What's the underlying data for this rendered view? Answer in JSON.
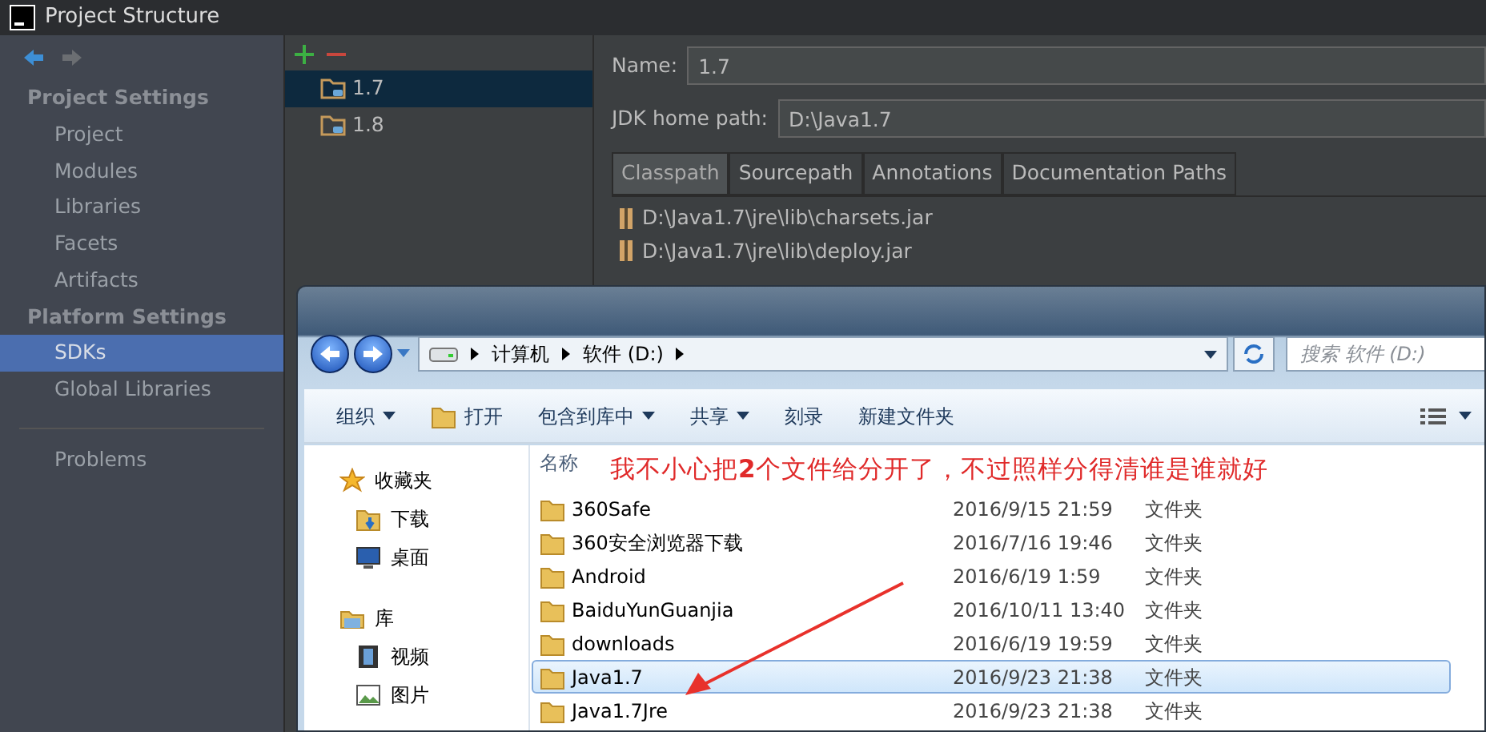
{
  "window": {
    "title": "Project Structure"
  },
  "sidebar": {
    "sections": [
      {
        "title": "Project Settings",
        "items": [
          {
            "label": "Project",
            "selected": false
          },
          {
            "label": "Modules",
            "selected": false
          },
          {
            "label": "Libraries",
            "selected": false
          },
          {
            "label": "Facets",
            "selected": false
          },
          {
            "label": "Artifacts",
            "selected": false
          }
        ]
      },
      {
        "title": "Platform Settings",
        "items": [
          {
            "label": "SDKs",
            "selected": true
          },
          {
            "label": "Global Libraries",
            "selected": false
          }
        ]
      }
    ],
    "footer_items": [
      {
        "label": "Problems",
        "selected": false
      }
    ]
  },
  "sdk_list": {
    "items": [
      {
        "label": "1.7",
        "selected": true
      },
      {
        "label": "1.8",
        "selected": false
      }
    ]
  },
  "details": {
    "name_label": "Name:",
    "name_value": "1.7",
    "path_label": "JDK home path:",
    "path_value": "D:\\Java1.7",
    "tabs": [
      {
        "label": "Classpath",
        "selected": true
      },
      {
        "label": "Sourcepath",
        "selected": false
      },
      {
        "label": "Annotations",
        "selected": false
      },
      {
        "label": "Documentation Paths",
        "selected": false
      }
    ],
    "classpath": [
      "D:\\Java1.7\\jre\\lib\\charsets.jar",
      "D:\\Java1.7\\jre\\lib\\deploy.jar"
    ]
  },
  "explorer": {
    "breadcrumb": [
      "计算机",
      "软件 (D:)"
    ],
    "search": {
      "placeholder": "搜索 软件 (D:)"
    },
    "toolbar": [
      {
        "label": "组织",
        "kind": "menu"
      },
      {
        "label": "打开",
        "kind": "open"
      },
      {
        "label": "包含到库中",
        "kind": "menu"
      },
      {
        "label": "共享",
        "kind": "menu"
      },
      {
        "label": "刻录",
        "kind": "plain"
      },
      {
        "label": "新建文件夹",
        "kind": "plain"
      }
    ],
    "nav": [
      {
        "label": "收藏夹",
        "kind": "star",
        "children": [
          {
            "label": "下载",
            "kind": "download"
          },
          {
            "label": "桌面",
            "kind": "desktop"
          }
        ]
      },
      {
        "label": "库",
        "kind": "library",
        "children": [
          {
            "label": "视频",
            "kind": "video"
          },
          {
            "label": "图片",
            "kind": "picture"
          }
        ]
      }
    ],
    "columns": [
      "名称"
    ],
    "rows": [
      {
        "name": "360Safe",
        "date": "2016/9/15 21:59",
        "type": "文件夹",
        "selected": false
      },
      {
        "name": "360安全浏览器下载",
        "date": "2016/7/16 19:46",
        "type": "文件夹",
        "selected": false
      },
      {
        "name": "Android",
        "date": "2016/6/19 1:59",
        "type": "文件夹",
        "selected": false
      },
      {
        "name": "BaiduYunGuanjia",
        "date": "2016/10/11 13:40",
        "type": "文件夹",
        "selected": false
      },
      {
        "name": "downloads",
        "date": "2016/6/19 19:59",
        "type": "文件夹",
        "selected": false
      },
      {
        "name": "Java1.7",
        "date": "2016/9/23 21:38",
        "type": "文件夹",
        "selected": true
      },
      {
        "name": "Java1.7Jre",
        "date": "2016/9/23 21:38",
        "type": "文件夹",
        "selected": false
      }
    ]
  },
  "annotation": {
    "text": "我不小心把**2**个文件给分开了，不过照样分得清谁是谁就好"
  }
}
